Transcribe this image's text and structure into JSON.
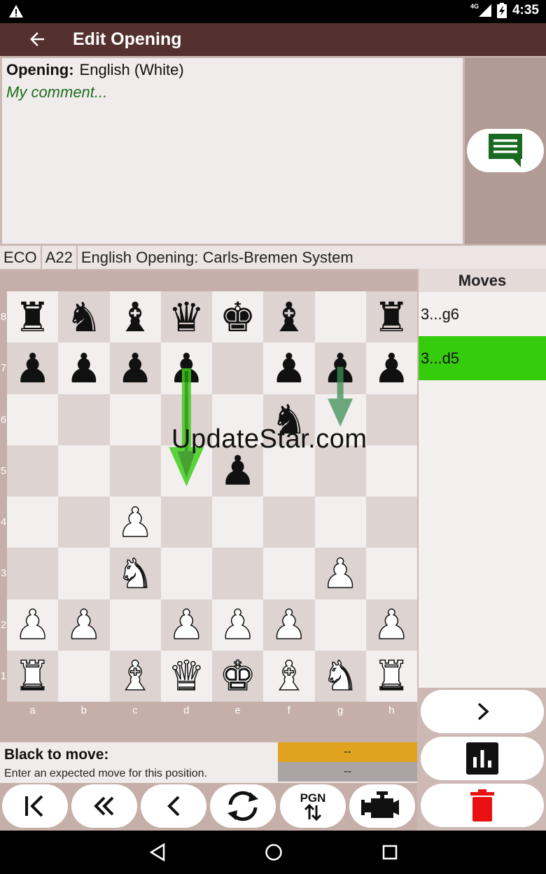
{
  "status_bar": {
    "time": "4:35",
    "network": "4G"
  },
  "app_bar": {
    "title": "Edit Opening"
  },
  "comment": {
    "opening_label": "Opening:",
    "opening_value": "English (White)",
    "comment_text": "My comment..."
  },
  "eco": {
    "label": "ECO",
    "code": "A22",
    "name": "English Opening: Carls-Bremen System"
  },
  "board": {
    "ranks": [
      "8",
      "7",
      "6",
      "5",
      "4",
      "3",
      "2",
      "1"
    ],
    "files": [
      "a",
      "b",
      "c",
      "d",
      "e",
      "f",
      "g",
      "h"
    ],
    "position": [
      [
        "br",
        "bn",
        "bb",
        "bq",
        "bk",
        "bb",
        "",
        "br"
      ],
      [
        "bp",
        "bp",
        "bp",
        "bp",
        "",
        "bp",
        "bp",
        "bp"
      ],
      [
        "",
        "",
        "",
        "",
        "",
        "bn",
        "",
        ""
      ],
      [
        "",
        "",
        "",
        "",
        "bp",
        "",
        "",
        ""
      ],
      [
        "",
        "",
        "wp",
        "",
        "",
        "",
        "",
        ""
      ],
      [
        "",
        "",
        "wn",
        "",
        "",
        "",
        "wp",
        ""
      ],
      [
        "wp",
        "wp",
        "",
        "wp",
        "wp",
        "wp",
        "",
        "wp"
      ],
      [
        "wr",
        "",
        "wb",
        "wq",
        "wk",
        "wb",
        "wn",
        "wr"
      ]
    ],
    "arrows": [
      {
        "from": "d7",
        "to": "d5",
        "color": "#3fcf1a"
      },
      {
        "from": "g7",
        "to": "g6",
        "color": "#3c8f55"
      }
    ],
    "watermark": "UpdateStar.com"
  },
  "moves": {
    "header": "Moves",
    "items": [
      {
        "label": "3...g6",
        "selected": false
      },
      {
        "label": "3...d5",
        "selected": true
      }
    ]
  },
  "status": {
    "to_move": "Black to move:",
    "hint": "Enter an expected move for this position.",
    "eval_top": "--",
    "eval_bottom": "--"
  },
  "toolbar": {
    "pgn_label": "PGN"
  },
  "colors": {
    "app_bar": "#54302e",
    "selected_move": "#36cc0e",
    "eval_top": "#e0a320",
    "delete": "#e81010",
    "chat_icon": "#1a6a22"
  }
}
